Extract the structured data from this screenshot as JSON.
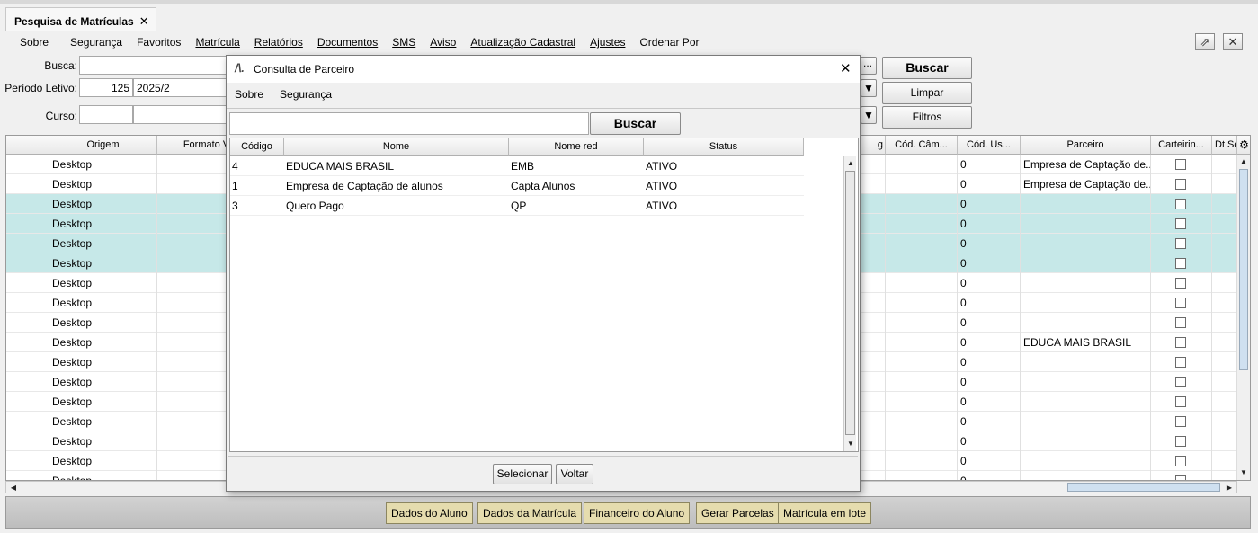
{
  "tab": {
    "title": "Pesquisa de Matrículas",
    "close": "✕"
  },
  "menu": [
    {
      "label": "Sobre",
      "u": "o"
    },
    {
      "label": "Segurança"
    },
    {
      "label": "Favoritos"
    },
    {
      "label": "Matrícula"
    },
    {
      "label": "Relatórios"
    },
    {
      "label": "Documentos"
    },
    {
      "label": "SMS"
    },
    {
      "label": "Aviso"
    },
    {
      "label": "Atualização Cadastral"
    },
    {
      "label": "Ajustes"
    },
    {
      "label": "Ordenar Por"
    }
  ],
  "window_icons": {
    "popout": "⇗",
    "close": "✕"
  },
  "filters": {
    "busca_label": "Busca:",
    "periodo_label": "Período Letivo:",
    "periodo_code": "125",
    "periodo_value": "2025/2",
    "curso_label": "Curso:",
    "buscar": "Buscar",
    "limpar": "Limpar",
    "filtros": "Filtros",
    "ellipsis": "..."
  },
  "grid": {
    "headers": {
      "origem": "Origem",
      "formato": "Formato V",
      "g": "g",
      "cod_cam": "Cód. Câm...",
      "cod_us": "Cód. Us...",
      "parceiro": "Parceiro",
      "carteirinha": "Carteirin...",
      "dt": "Dt Sc"
    },
    "rows": [
      {
        "origem": "Desktop",
        "cod_us": "0",
        "parceiro": "Empresa de Captação de...",
        "selected": false
      },
      {
        "origem": "Desktop",
        "cod_us": "0",
        "parceiro": "Empresa de Captação de...",
        "selected": false
      },
      {
        "origem": "Desktop",
        "cod_us": "0",
        "parceiro": "",
        "selected": true
      },
      {
        "origem": "Desktop",
        "cod_us": "0",
        "parceiro": "",
        "selected": true
      },
      {
        "origem": "Desktop",
        "cod_us": "0",
        "parceiro": "",
        "selected": true
      },
      {
        "origem": "Desktop",
        "cod_us": "0",
        "parceiro": "",
        "selected": true
      },
      {
        "origem": "Desktop",
        "cod_us": "0",
        "parceiro": "",
        "selected": false
      },
      {
        "origem": "Desktop",
        "cod_us": "0",
        "parceiro": "",
        "selected": false
      },
      {
        "origem": "Desktop",
        "cod_us": "0",
        "parceiro": "",
        "selected": false
      },
      {
        "origem": "Desktop",
        "cod_us": "0",
        "parceiro": "EDUCA MAIS BRASIL",
        "selected": false
      },
      {
        "origem": "Desktop",
        "cod_us": "0",
        "parceiro": "",
        "selected": false
      },
      {
        "origem": "Desktop",
        "cod_us": "0",
        "parceiro": "",
        "selected": false
      },
      {
        "origem": "Desktop",
        "cod_us": "0",
        "parceiro": "",
        "selected": false
      },
      {
        "origem": "Desktop",
        "cod_us": "0",
        "parceiro": "",
        "selected": false
      },
      {
        "origem": "Desktop",
        "cod_us": "0",
        "parceiro": "",
        "selected": false
      },
      {
        "origem": "Desktop",
        "cod_us": "0",
        "parceiro": "",
        "selected": false
      },
      {
        "origem": "Desktop",
        "cod_us": "0",
        "parceiro": "",
        "selected": false
      }
    ]
  },
  "bottom_buttons": [
    "Dados do Aluno",
    "Dados da Matrícula",
    "Financeiro do Aluno",
    "Gerar Parcelas",
    "Matrícula em lote"
  ],
  "dialog": {
    "title": "Consulta de Parceiro",
    "close": "✕",
    "menu": [
      "Sobre",
      "Segurança"
    ],
    "search_value": "",
    "buscar": "Buscar",
    "headers": [
      "Código",
      "Nome",
      "Nome red",
      "Status"
    ],
    "rows": [
      [
        "4",
        "EDUCA MAIS BRASIL",
        "EMB",
        "ATIVO"
      ],
      [
        "1",
        "Empresa de Captação de alunos",
        "Capta Alunos",
        "ATIVO"
      ],
      [
        "3",
        "Quero Pago",
        "QP",
        "ATIVO"
      ]
    ],
    "selecionar": "Selecionar",
    "voltar": "Voltar"
  }
}
